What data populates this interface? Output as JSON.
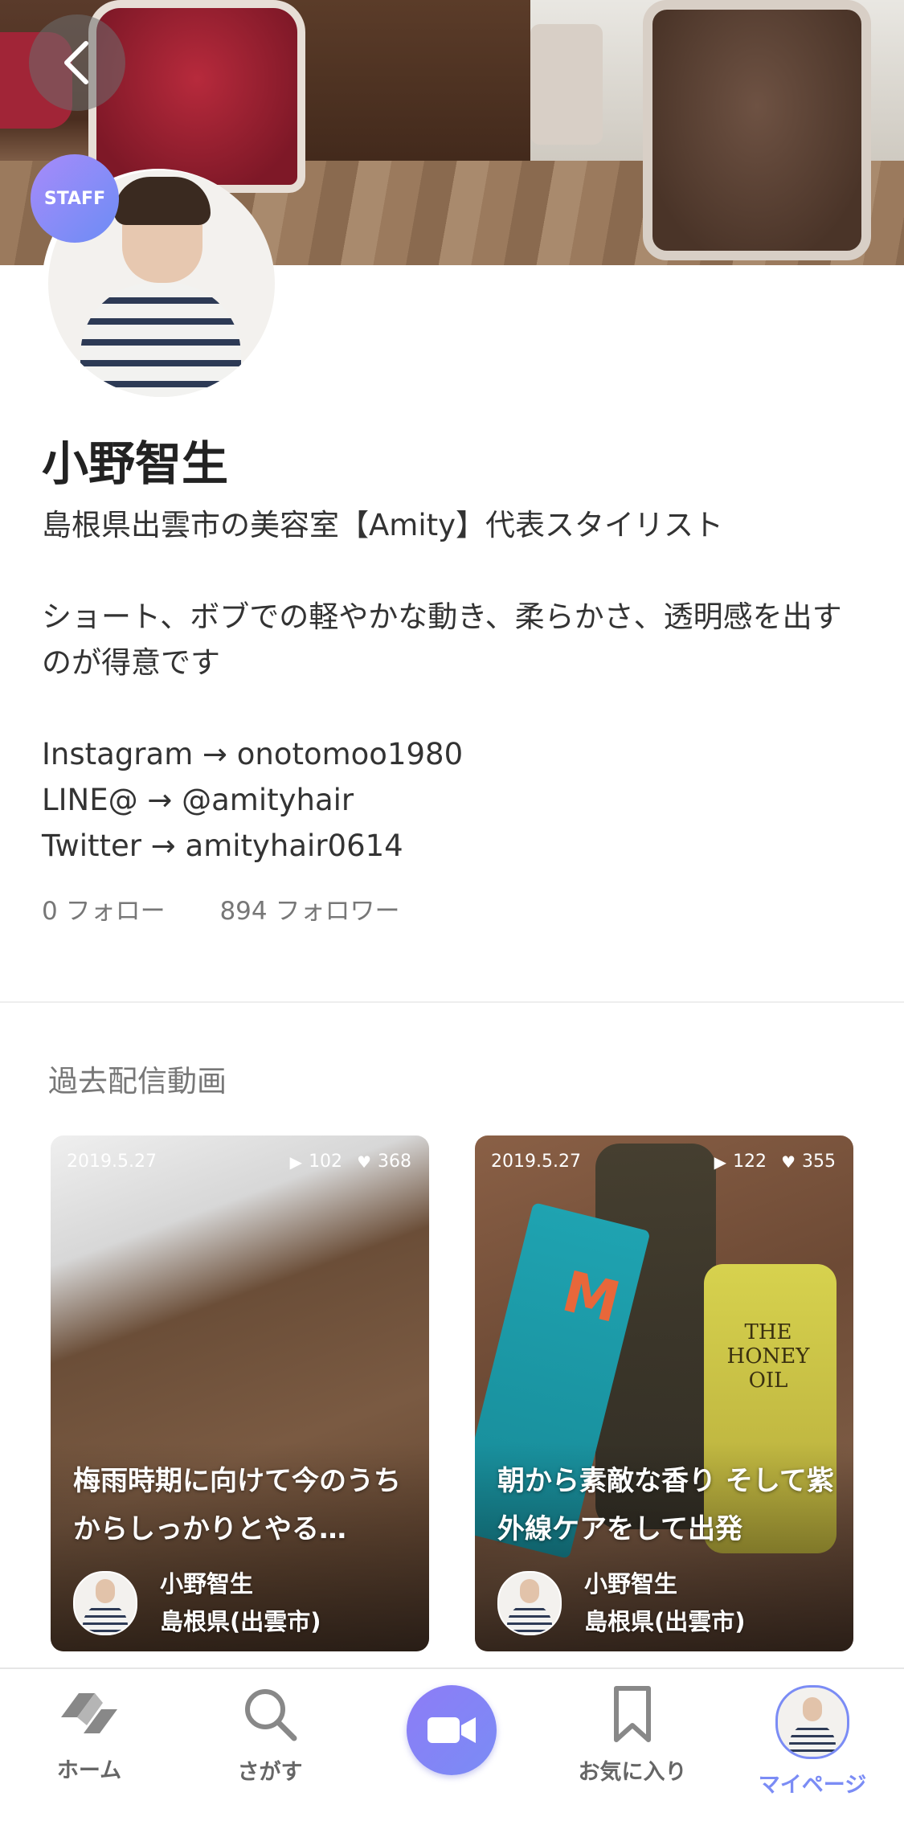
{
  "header": {
    "staff_badge": "STAFF"
  },
  "profile": {
    "name": "小野智生",
    "bio": "島根県出雲市の美容室【Amity】代表スタイリスト\n\nショート、ボブでの軽やかな動き、柔らかさ、透明感を出すのが得意です\n\nInstagram →  onotomoo1980\nLINE@       →  @amityhair\nTwitter      →   amityhair0614",
    "following": "0 フォロー",
    "followers": "894 フォロワー"
  },
  "videos": {
    "section_title": "過去配信動画",
    "items": [
      {
        "date": "2019.5.27",
        "plays": "102",
        "likes": "368",
        "title": "梅雨時期に向けて今のうちからしっかりとやる…",
        "author_name": "小野智生",
        "author_location": "島根県(出雲市)"
      },
      {
        "date": "2019.5.27",
        "plays": "122",
        "likes": "355",
        "title": "朝から素敵な香り そして紫外線ケアをして出発",
        "author_name": "小野智生",
        "author_location": "島根県(出雲市)",
        "product_text_1": "M",
        "product_text_2": "THE\nHONEY\nOIL"
      }
    ]
  },
  "tabbar": {
    "home": "ホーム",
    "search": "さがす",
    "favorites": "お気に入り",
    "mypage": "マイページ",
    "active": "mypage",
    "accent_color": "#7b8cf5"
  }
}
